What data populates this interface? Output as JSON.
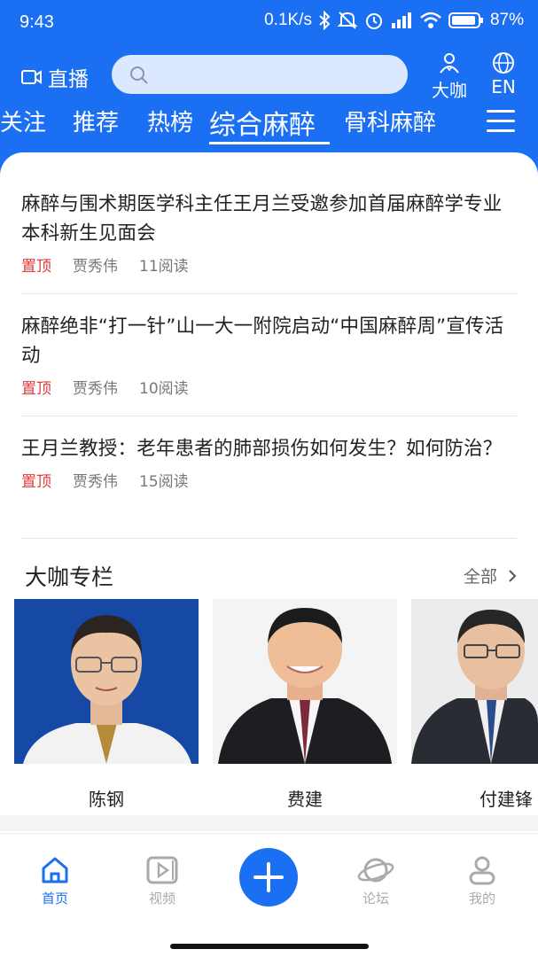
{
  "status": {
    "time": "9:43",
    "net_speed": "0.1K/s",
    "battery": "87%"
  },
  "topbar": {
    "live_label": "直播",
    "daka_label": "大咖",
    "lang_label": "EN",
    "search_placeholder": ""
  },
  "tabs": [
    {
      "label": "关注"
    },
    {
      "label": "推荐"
    },
    {
      "label": "热榜"
    },
    {
      "label": "综合麻醉",
      "active": true
    },
    {
      "label": "骨科麻醉"
    }
  ],
  "articles": [
    {
      "title": "麻醉与围术期医学科主任王月兰受邀参加首届麻醉学专业本科新生见面会",
      "tag": "置顶",
      "author": "贾秀伟",
      "reads": "11阅读"
    },
    {
      "title": "麻醉绝非“打一针”山一大一附院启动“中国麻醉周”宣传活动",
      "tag": "置顶",
      "author": "贾秀伟",
      "reads": "10阅读"
    },
    {
      "title": "王月兰教授：老年患者的肺部损伤如何发生？如何防治？",
      "tag": "置顶",
      "author": "贾秀伟",
      "reads": "15阅读"
    }
  ],
  "expert_section": {
    "title": "大咖专栏",
    "all_label": "全部",
    "experts": [
      {
        "name": "陈钢"
      },
      {
        "name": "费建"
      },
      {
        "name": "付建锋"
      }
    ]
  },
  "bottom_nav": [
    {
      "label": "首页",
      "icon": "home-icon",
      "active": true
    },
    {
      "label": "视频",
      "icon": "video-icon"
    },
    {
      "label": "",
      "icon": "plus-icon"
    },
    {
      "label": "论坛",
      "icon": "planet-icon"
    },
    {
      "label": "我的",
      "icon": "user-icon"
    }
  ],
  "colors": {
    "brand": "#1b6ff3",
    "pin_tag": "#e23a3a"
  }
}
